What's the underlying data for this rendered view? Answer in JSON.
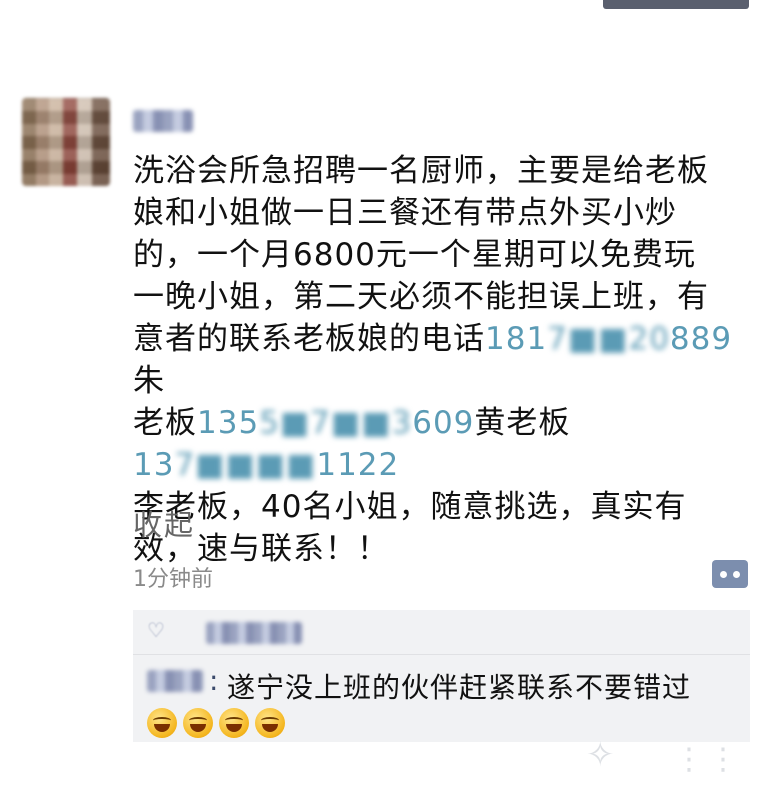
{
  "post": {
    "lines": [
      "洗浴会所急招聘一名厨师，主要是给老板",
      "娘和小姐做一日三餐还有带点外买小炒",
      "的，一个月6800元一个星期可以免费玩",
      "一晚小姐，第二天必须不能担误上班，有"
    ],
    "line5_text": "意者的联系老板娘的电话",
    "phone1": "181",
    "phone1_end": "889",
    "name1": "朱",
    "line6_text": "老板",
    "phone2": "135",
    "phone2_end": "609",
    "name2": "黄老板",
    "phone3": "13",
    "phone3_end": "1122",
    "line7": "李老板，40名小姐，随意挑选，真实有",
    "line8": "效，速与联系！！"
  },
  "collapse_label": "收起",
  "timestamp": "1分钟前",
  "comment": {
    "text": "遂宁没上班的伙伴赶紧联系不要错过"
  },
  "icons": {
    "more": "more-dots-icon",
    "like": "heart-icon",
    "emoji": "grin-emoji-icon"
  }
}
